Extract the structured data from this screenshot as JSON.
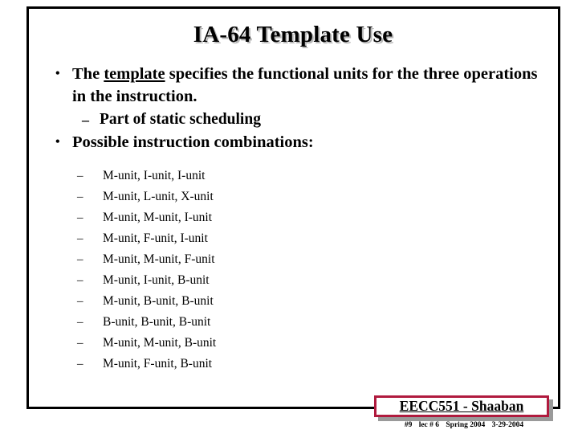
{
  "slide": {
    "title": "IA-64 Template Use",
    "colors": {
      "text": "#000000",
      "frame": "#000000",
      "badge_border": "#b01a3e",
      "badge_shadow": "#9a9a9a",
      "title_shadow": "#b8b8b8",
      "background": "#ffffff"
    }
  },
  "body": {
    "bullet_glyph": "•",
    "dash_glyph": "–",
    "points": [
      {
        "level": 1,
        "prefix": "The ",
        "emphasis": "template",
        "suffix": " specifies the functional units for the three operations in the instruction."
      },
      {
        "level": 2,
        "text": "Part of static scheduling"
      },
      {
        "level": 1,
        "text": "Possible instruction combinations:"
      }
    ],
    "combinations": [
      "M-unit, I-unit, I-unit",
      "M-unit, L-unit, X-unit",
      "M-unit, M-unit, I-unit",
      "M-unit, F-unit, I-unit",
      "M-unit, M-unit, F-unit",
      "M-unit, I-unit, B-unit",
      "M-unit, B-unit, B-unit",
      "B-unit, B-unit, B-unit",
      "M-unit, M-unit, B-unit",
      "M-unit, F-unit, B-unit"
    ]
  },
  "footer": {
    "badge_text": "EECC551 - Shaaban",
    "slide_number": "#9",
    "lecture": "lec # 6",
    "term": "Spring 2004",
    "date": "3-29-2004"
  }
}
